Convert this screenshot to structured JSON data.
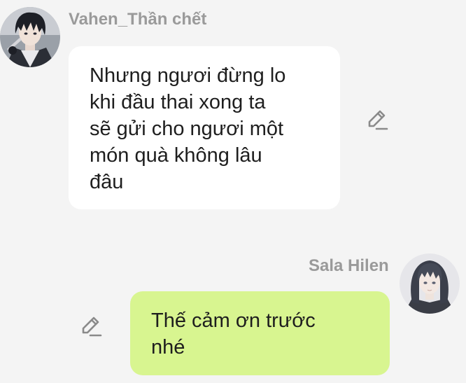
{
  "messages": [
    {
      "sender": "Vahen_Thần chết",
      "text": "Nhưng ngươi đừng lo\nkhi đầu thai xong ta\nsẽ gửi cho ngươi một\nmón quà không lâu\nđâu",
      "side": "left",
      "avatar_icon": "avatar-dark-haired-boy-icon",
      "edit_icon": "pencil-icon"
    },
    {
      "sender": "Sala Hilen",
      "text": "Thế cảm ơn trước\nnhé",
      "side": "right",
      "avatar_icon": "avatar-dark-haired-girl-icon",
      "edit_icon": "pencil-icon"
    }
  ],
  "colors": {
    "background": "#f4f4f4",
    "left_bubble": "#ffffff",
    "right_bubble": "#d8f590",
    "sender_name": "#9a9a9a",
    "message_text": "#1e1e1e",
    "icon": "#8a8a8a"
  }
}
